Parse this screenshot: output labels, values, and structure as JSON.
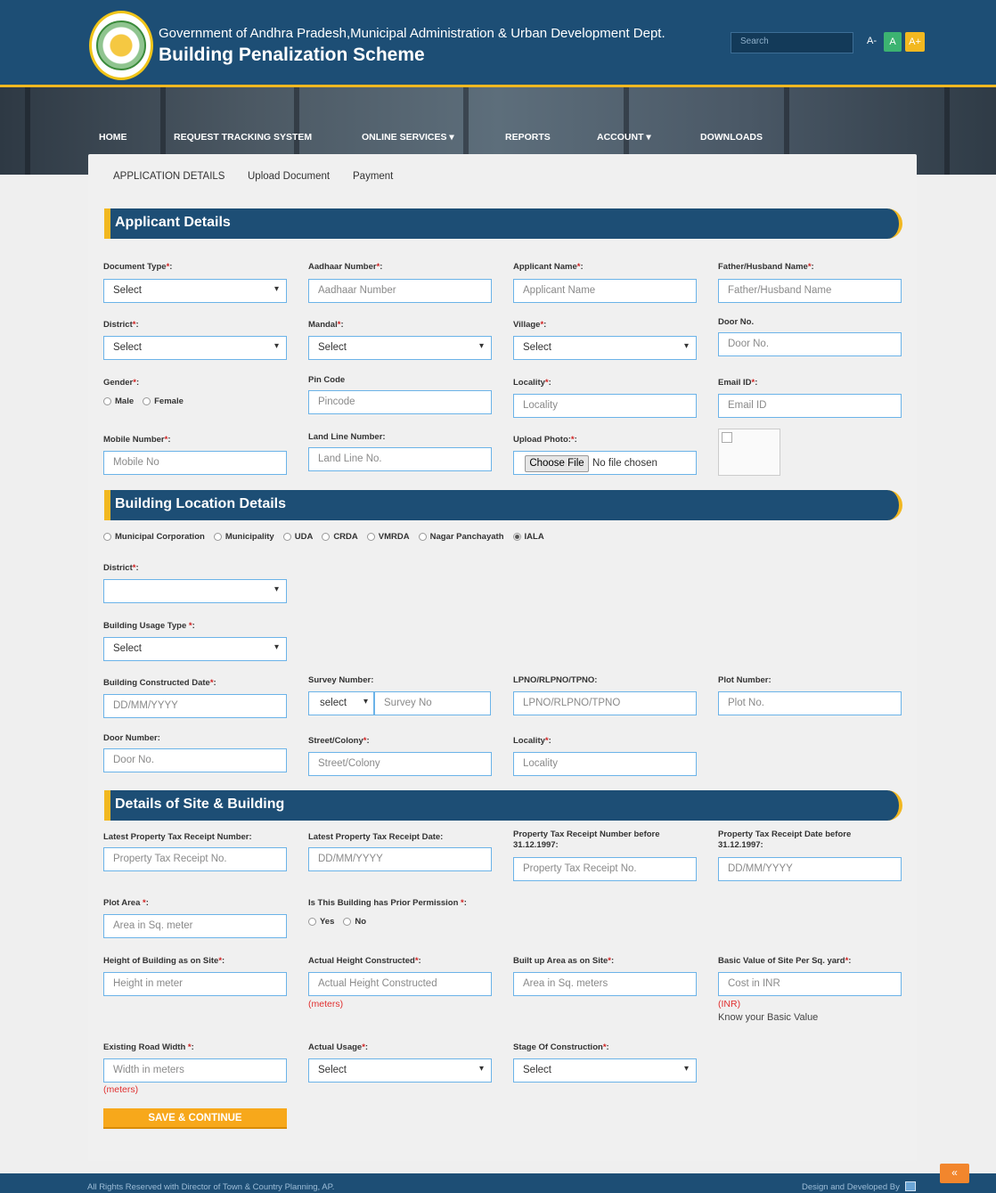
{
  "header": {
    "gov_line": "Government of Andhra Pradesh,Municipal Administration & Urban Development Dept.",
    "title": "Building Penalization Scheme",
    "search_placeholder": "Search",
    "font_small": "A-",
    "font_normal": "A",
    "font_large": "A+"
  },
  "nav": [
    "HOME",
    "REQUEST TRACKING SYSTEM",
    "ONLINE SERVICES ▾",
    "REPORTS",
    "ACCOUNT ▾",
    "DOWNLOADS"
  ],
  "subtabs": [
    "APPLICATION DETAILS",
    "Upload Document",
    "Payment"
  ],
  "applicant": {
    "section_title": "Applicant Details",
    "document_type": {
      "label": "Document Type",
      "value": "Select"
    },
    "aadhaar": {
      "label": "Aadhaar Number",
      "placeholder": "Aadhaar Number"
    },
    "applicant_name": {
      "label": "Applicant Name",
      "placeholder": "Applicant Name"
    },
    "father_name": {
      "label": "Father/Husband Name",
      "placeholder": "Father/Husband Name"
    },
    "district": {
      "label": "District",
      "value": "Select"
    },
    "mandal": {
      "label": "Mandal",
      "value": "Select"
    },
    "village": {
      "label": "Village",
      "value": "Select"
    },
    "door_no": {
      "label": "Door No.",
      "placeholder": "Door No."
    },
    "gender": {
      "label": "Gender",
      "male": "Male",
      "female": "Female"
    },
    "pin_code": {
      "label": "Pin Code",
      "placeholder": "Pincode"
    },
    "locality": {
      "label": "Locality",
      "placeholder": "Locality"
    },
    "email": {
      "label": "Email ID",
      "placeholder": "Email ID"
    },
    "mobile": {
      "label": "Mobile Number",
      "placeholder": "Mobile No"
    },
    "landline": {
      "label": "Land Line Number:",
      "placeholder": "Land Line No."
    },
    "photo": {
      "label": "Upload Photo:",
      "button": "Choose File",
      "status": "No file chosen"
    }
  },
  "location": {
    "section_title": "Building Location Details",
    "authority_types": [
      "Municipal Corporation",
      "Municipality",
      "UDA",
      "CRDA",
      "VMRDA",
      "Nagar Panchayath",
      "IALA"
    ],
    "selected_authority": "IALA",
    "district": {
      "label": "District",
      "value": ""
    },
    "usage_type": {
      "label": "Building Usage Type ",
      "value": "Select"
    },
    "constructed_date": {
      "label": "Building Constructed Date",
      "placeholder": "DD/MM/YYYY"
    },
    "survey": {
      "label": "Survey Number:",
      "select_value": "select",
      "placeholder": "Survey No"
    },
    "lpno": {
      "label": "LPNO/RLPNO/TPNO:",
      "placeholder": "LPNO/RLPNO/TPNO"
    },
    "plot_no": {
      "label": "Plot Number:",
      "placeholder": "Plot No."
    },
    "door_no": {
      "label": "Door Number:",
      "placeholder": "Door No."
    },
    "street": {
      "label": "Street/Colony",
      "placeholder": "Street/Colony"
    },
    "locality": {
      "label": "Locality",
      "placeholder": "Locality"
    }
  },
  "site": {
    "section_title": "Details of Site & Building",
    "receipt_no": {
      "label": "Latest Property Tax Receipt Number:",
      "placeholder": "Property Tax Receipt No."
    },
    "receipt_date": {
      "label": "Latest Property Tax Receipt Date:",
      "placeholder": "DD/MM/YYYY"
    },
    "old_receipt_no": {
      "label": "Property Tax Receipt Number before 31.12.1997:",
      "placeholder": "Property Tax Receipt No."
    },
    "old_receipt_date": {
      "label": "Property Tax Receipt Date before 31.12.1997:",
      "placeholder": "DD/MM/YYYY"
    },
    "plot_area": {
      "label": "Plot Area ",
      "placeholder": "Area in Sq. meter"
    },
    "prior_permission": {
      "label": "Is This Building has Prior Permission ",
      "yes": "Yes",
      "no": "No"
    },
    "height": {
      "label": "Height of Building as on Site",
      "placeholder": "Height in meter"
    },
    "actual_height": {
      "label": "Actual Height Constructed",
      "placeholder": "Actual Height Constructed",
      "unit": "(meters)"
    },
    "builtup": {
      "label": "Built up Area as on Site",
      "placeholder": "Area in Sq. meters"
    },
    "basic_value": {
      "label": "Basic Value of Site Per Sq. yard",
      "placeholder": "Cost in INR",
      "unit": "(INR)",
      "link": "Know your Basic Value"
    },
    "road_width": {
      "label": "Existing Road Width ",
      "placeholder": "Width in meters",
      "unit": "(meters)"
    },
    "actual_usage": {
      "label": "Actual Usage",
      "value": "Select"
    },
    "stage": {
      "label": "Stage Of Construction",
      "value": "Select"
    },
    "save_button": "SAVE & CONTINUE"
  },
  "footer": {
    "left": "All Rights Reserved with Director of Town & Country Planning, AP.",
    "right": "Design and Developed By",
    "scroll_top": "«"
  },
  "colors": {
    "primary": "#1d4e75",
    "accent": "#f2b820",
    "button": "#f7a81b",
    "required": "#d02020"
  }
}
